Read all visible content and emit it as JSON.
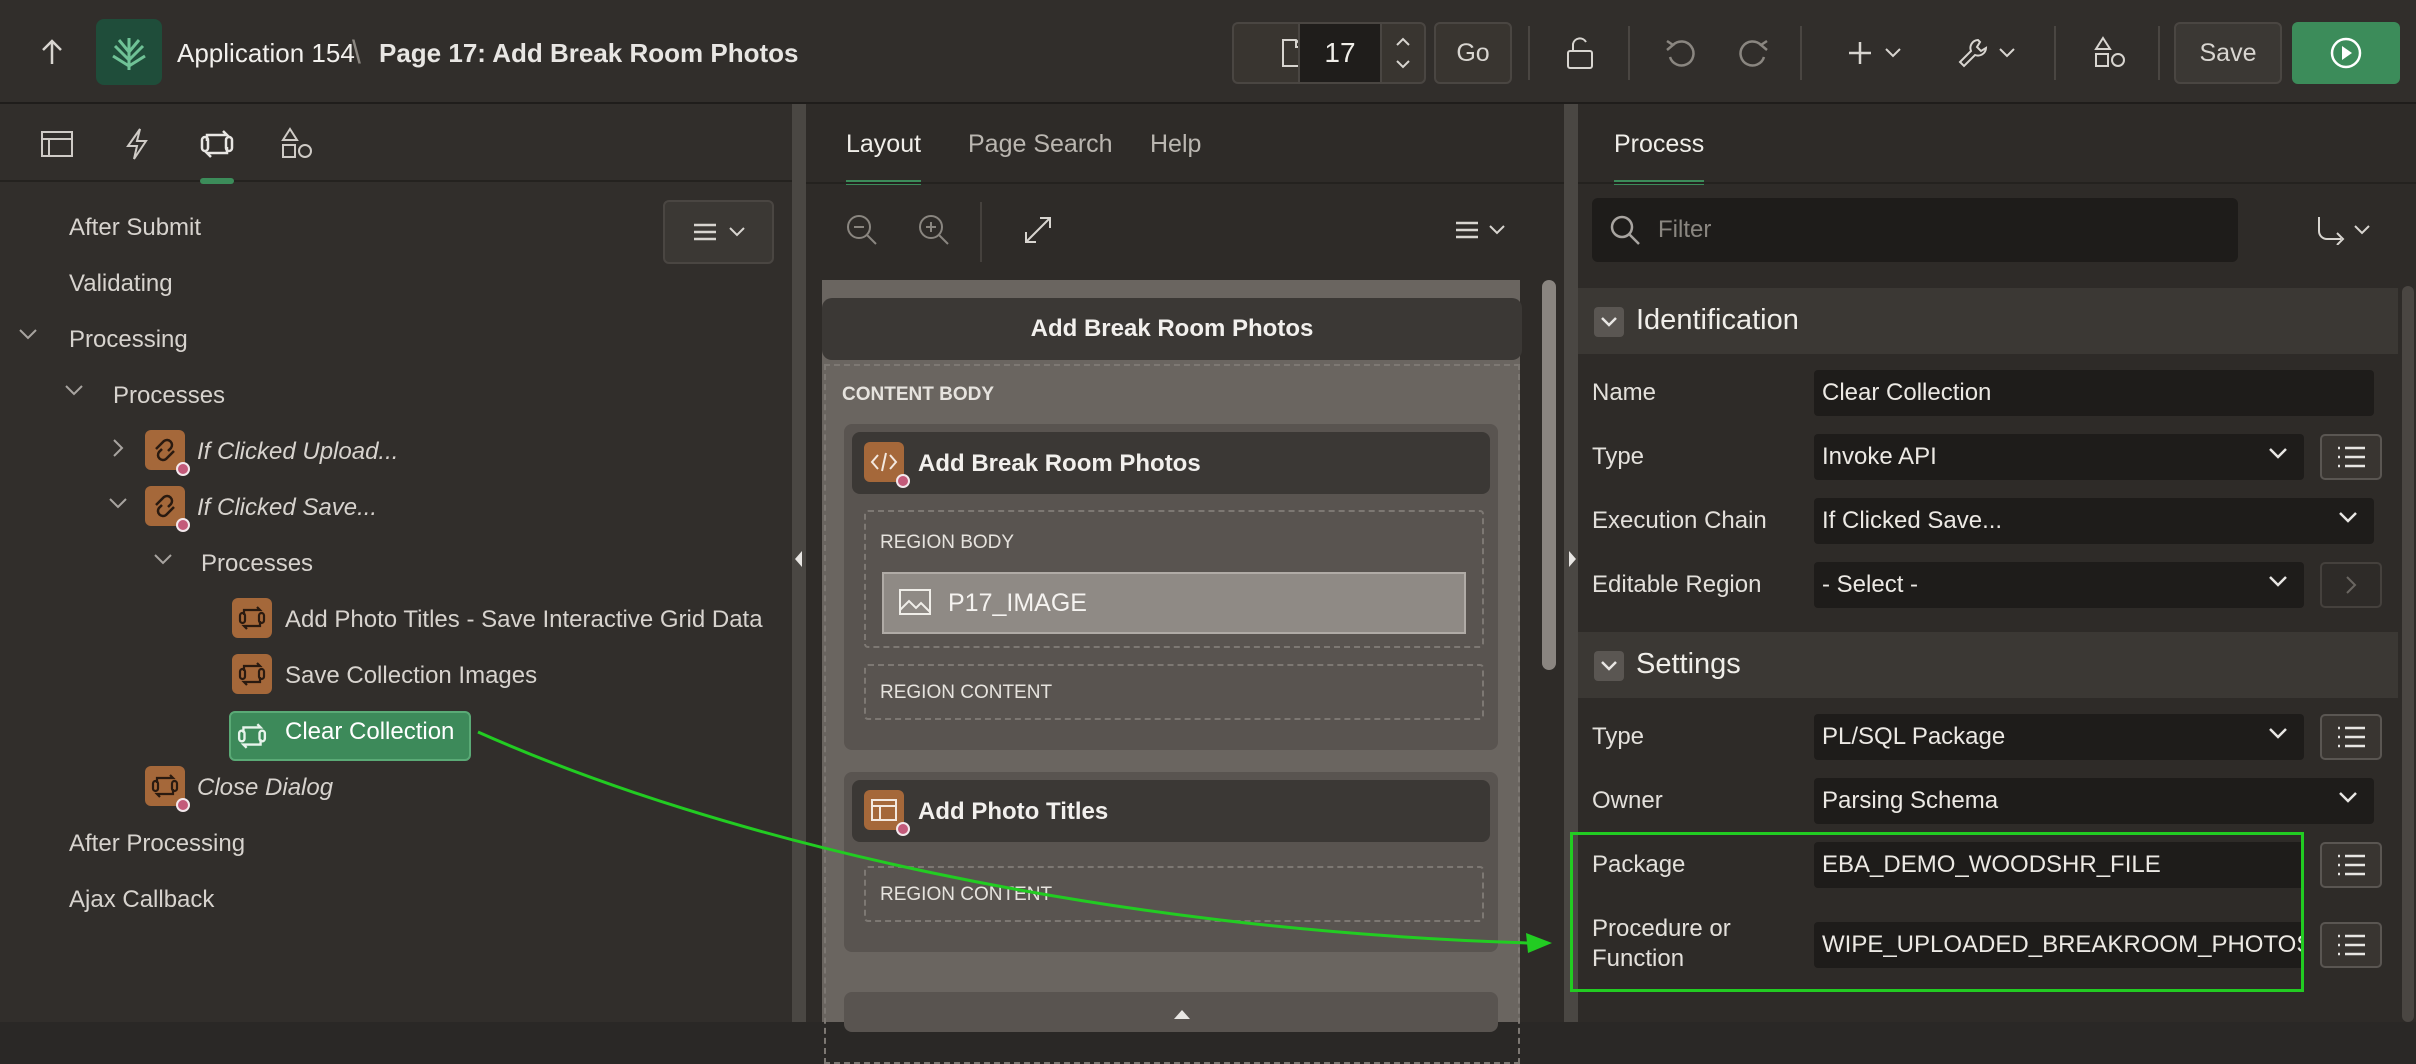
{
  "header": {
    "app_name": "Application 154",
    "separator": "\\",
    "page_title": "Page 17: Add Break Room Photos",
    "page_number": "17",
    "go_label": "Go",
    "save_label": "Save"
  },
  "left": {
    "tree": {
      "after_submit": "After Submit",
      "validating": "Validating",
      "processing": "Processing",
      "processes": "Processes",
      "if_clicked_upload": "If Clicked Upload...",
      "if_clicked_save": "If Clicked Save...",
      "sub_processes": "Processes",
      "add_photo_titles": "Add Photo Titles - Save Interactive Grid Data",
      "save_collection_images": "Save Collection Images",
      "clear_collection": "Clear Collection",
      "close_dialog": "Close Dialog",
      "after_processing": "After Processing",
      "ajax_callback": "Ajax Callback"
    }
  },
  "center": {
    "tabs": [
      "Layout",
      "Page Search",
      "Help"
    ],
    "page_region_title": "Add Break Room Photos",
    "content_body": "CONTENT BODY",
    "region1_title": "Add Break Room Photos",
    "region_body": "REGION BODY",
    "item_name": "P17_IMAGE",
    "region_content_1": "REGION CONTENT",
    "region2_title": "Add Photo Titles",
    "region_content_2": "REGION CONTENT"
  },
  "right": {
    "tab": "Process",
    "filter_placeholder": "Filter",
    "identification": {
      "title": "Identification",
      "name_label": "Name",
      "name_value": "Clear Collection",
      "type_label": "Type",
      "type_value": "Invoke API",
      "chain_label": "Execution Chain",
      "chain_value": "If Clicked Save...",
      "editable_label": "Editable Region",
      "editable_value": "- Select -"
    },
    "settings": {
      "title": "Settings",
      "type_label": "Type",
      "type_value": "PL/SQL Package",
      "owner_label": "Owner",
      "owner_value": "Parsing Schema",
      "package_label": "Package",
      "package_value": "EBA_DEMO_WOODSHR_FILE",
      "proc_label_1": "Procedure or",
      "proc_label_2": "Function",
      "proc_value": "WIPE_UPLOADED_BREAKROOM_PHOTOS"
    }
  },
  "colors": {
    "accent_green": "#3c8c5a",
    "annotation_green": "#22cc22",
    "process_icon": "#a5683a"
  }
}
